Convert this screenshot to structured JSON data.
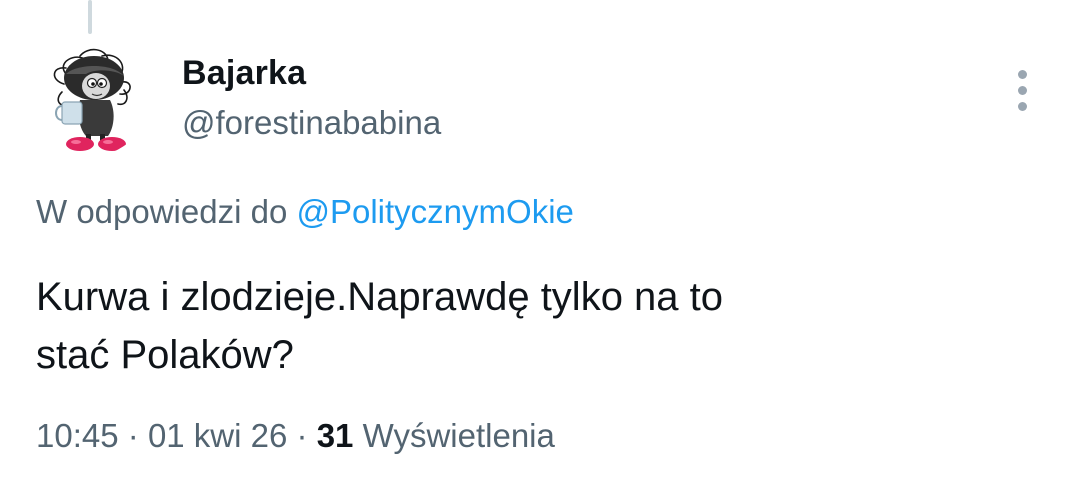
{
  "author": {
    "display_name": "Bajarka",
    "handle": "@forestinababina"
  },
  "reply": {
    "prefix": "W odpowiedzi do",
    "mention": "@PolitycznymOkie"
  },
  "tweet": {
    "text_line1": "Kurwa i zlodzieje.Naprawdę tylko na to",
    "text_line2": "stać Polaków?"
  },
  "meta": {
    "time": "10:45",
    "separator": "·",
    "date": "01 kwi 26",
    "views_count": "31",
    "views_label": "Wyświetlenia"
  },
  "icons": {
    "more": "more-vertical-icon",
    "avatar": "cartoon-character-avatar"
  },
  "colors": {
    "text_primary": "#0f1419",
    "text_secondary": "#536471",
    "link": "#1d9bf0",
    "thread_line": "#cfd9de"
  }
}
